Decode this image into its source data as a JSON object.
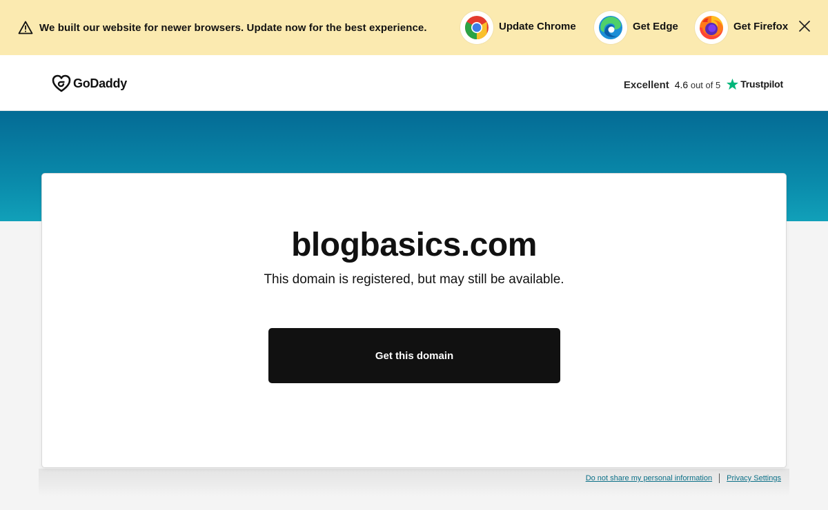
{
  "banner": {
    "message": "We built our website for newer browsers. Update now for the best experience.",
    "browsers": [
      {
        "label": "Update Chrome",
        "icon": "chrome-icon"
      },
      {
        "label": "Get Edge",
        "icon": "edge-icon"
      },
      {
        "label": "Get Firefox",
        "icon": "firefox-icon"
      }
    ],
    "background": "#fbeab0"
  },
  "header": {
    "logo_text": "GoDaddy",
    "rating": {
      "label": "Excellent",
      "score": "4.6",
      "score_suffix": "out of 5",
      "provider": "Trustpilot",
      "star_color": "#00b67a"
    }
  },
  "main": {
    "domain": "blogbasics.com",
    "subtitle": "This domain is registered, but may still be available.",
    "cta_label": "Get this domain",
    "hero_color": "#0a8bab"
  },
  "footer": {
    "links": [
      "Do not share my personal information",
      "Privacy Settings"
    ]
  }
}
